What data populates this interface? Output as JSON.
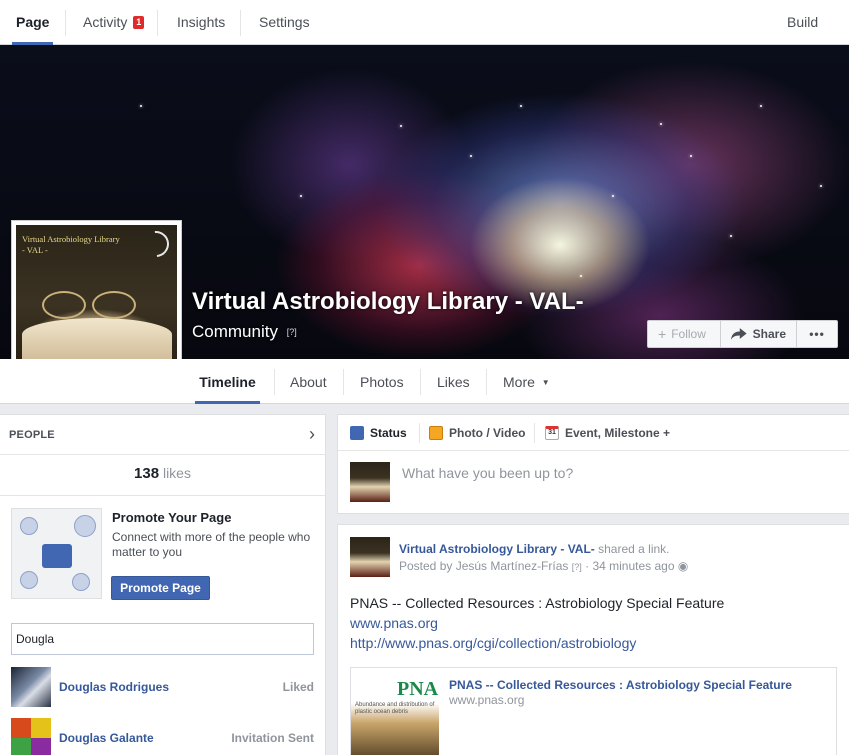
{
  "admin_tabs": {
    "page": "Page",
    "activity": "Activity",
    "activity_badge": "1",
    "insights": "Insights",
    "settings": "Settings",
    "build_audience": "Build Audi"
  },
  "cover": {
    "page_name": "Virtual Astrobiology Library - VAL-",
    "category": "Community",
    "category_help": "[?]",
    "profile_text_line1": "Virtual Astrobiology Library",
    "profile_text_line2": "- VAL -",
    "follow_label": "Follow",
    "share_label": "Share",
    "more_label": "•••"
  },
  "page_tabs": {
    "timeline": "Timeline",
    "about": "About",
    "photos": "Photos",
    "likes": "Likes",
    "more": "More"
  },
  "people": {
    "header": "PEOPLE",
    "likes_count": "138",
    "likes_label": "likes",
    "promote_title": "Promote Your Page",
    "promote_desc": "Connect with more of the people who matter to you",
    "promote_button": "Promote Page",
    "invite_value": "Dougla",
    "friends": [
      {
        "name": "Douglas Rodrigues",
        "status": "Liked"
      },
      {
        "name": "Douglas Galante",
        "status": "Invitation Sent"
      }
    ]
  },
  "composer": {
    "status": "Status",
    "photo_video": "Photo / Video",
    "event": "Event, Milestone +",
    "calendar_day": "31",
    "placeholder": "What have you been up to?"
  },
  "post": {
    "author": "Virtual Astrobiology Library - VAL-",
    "action": " shared a link.",
    "posted_by": "Posted by Jesús Martínez-Frías",
    "help": "[?]",
    "time": "· 34 minutes ago",
    "title": "PNAS -- Collected Resources : Astrobiology Special Feature",
    "link1": "www.pnas.org",
    "link2": "http://www.pnas.org/cgi/collection/astrobiology",
    "attachment_title": "PNAS -- Collected Resources : Astrobiology Special Feature",
    "attachment_host": "www.pnas.org",
    "attachment_logo": "PNAS",
    "attachment_small_text": "Abundance and distribution of plastic ocean debris"
  },
  "colors": {
    "brand_blue": "#4267b2",
    "link_blue": "#365899",
    "badge_red": "#e02b2b"
  }
}
